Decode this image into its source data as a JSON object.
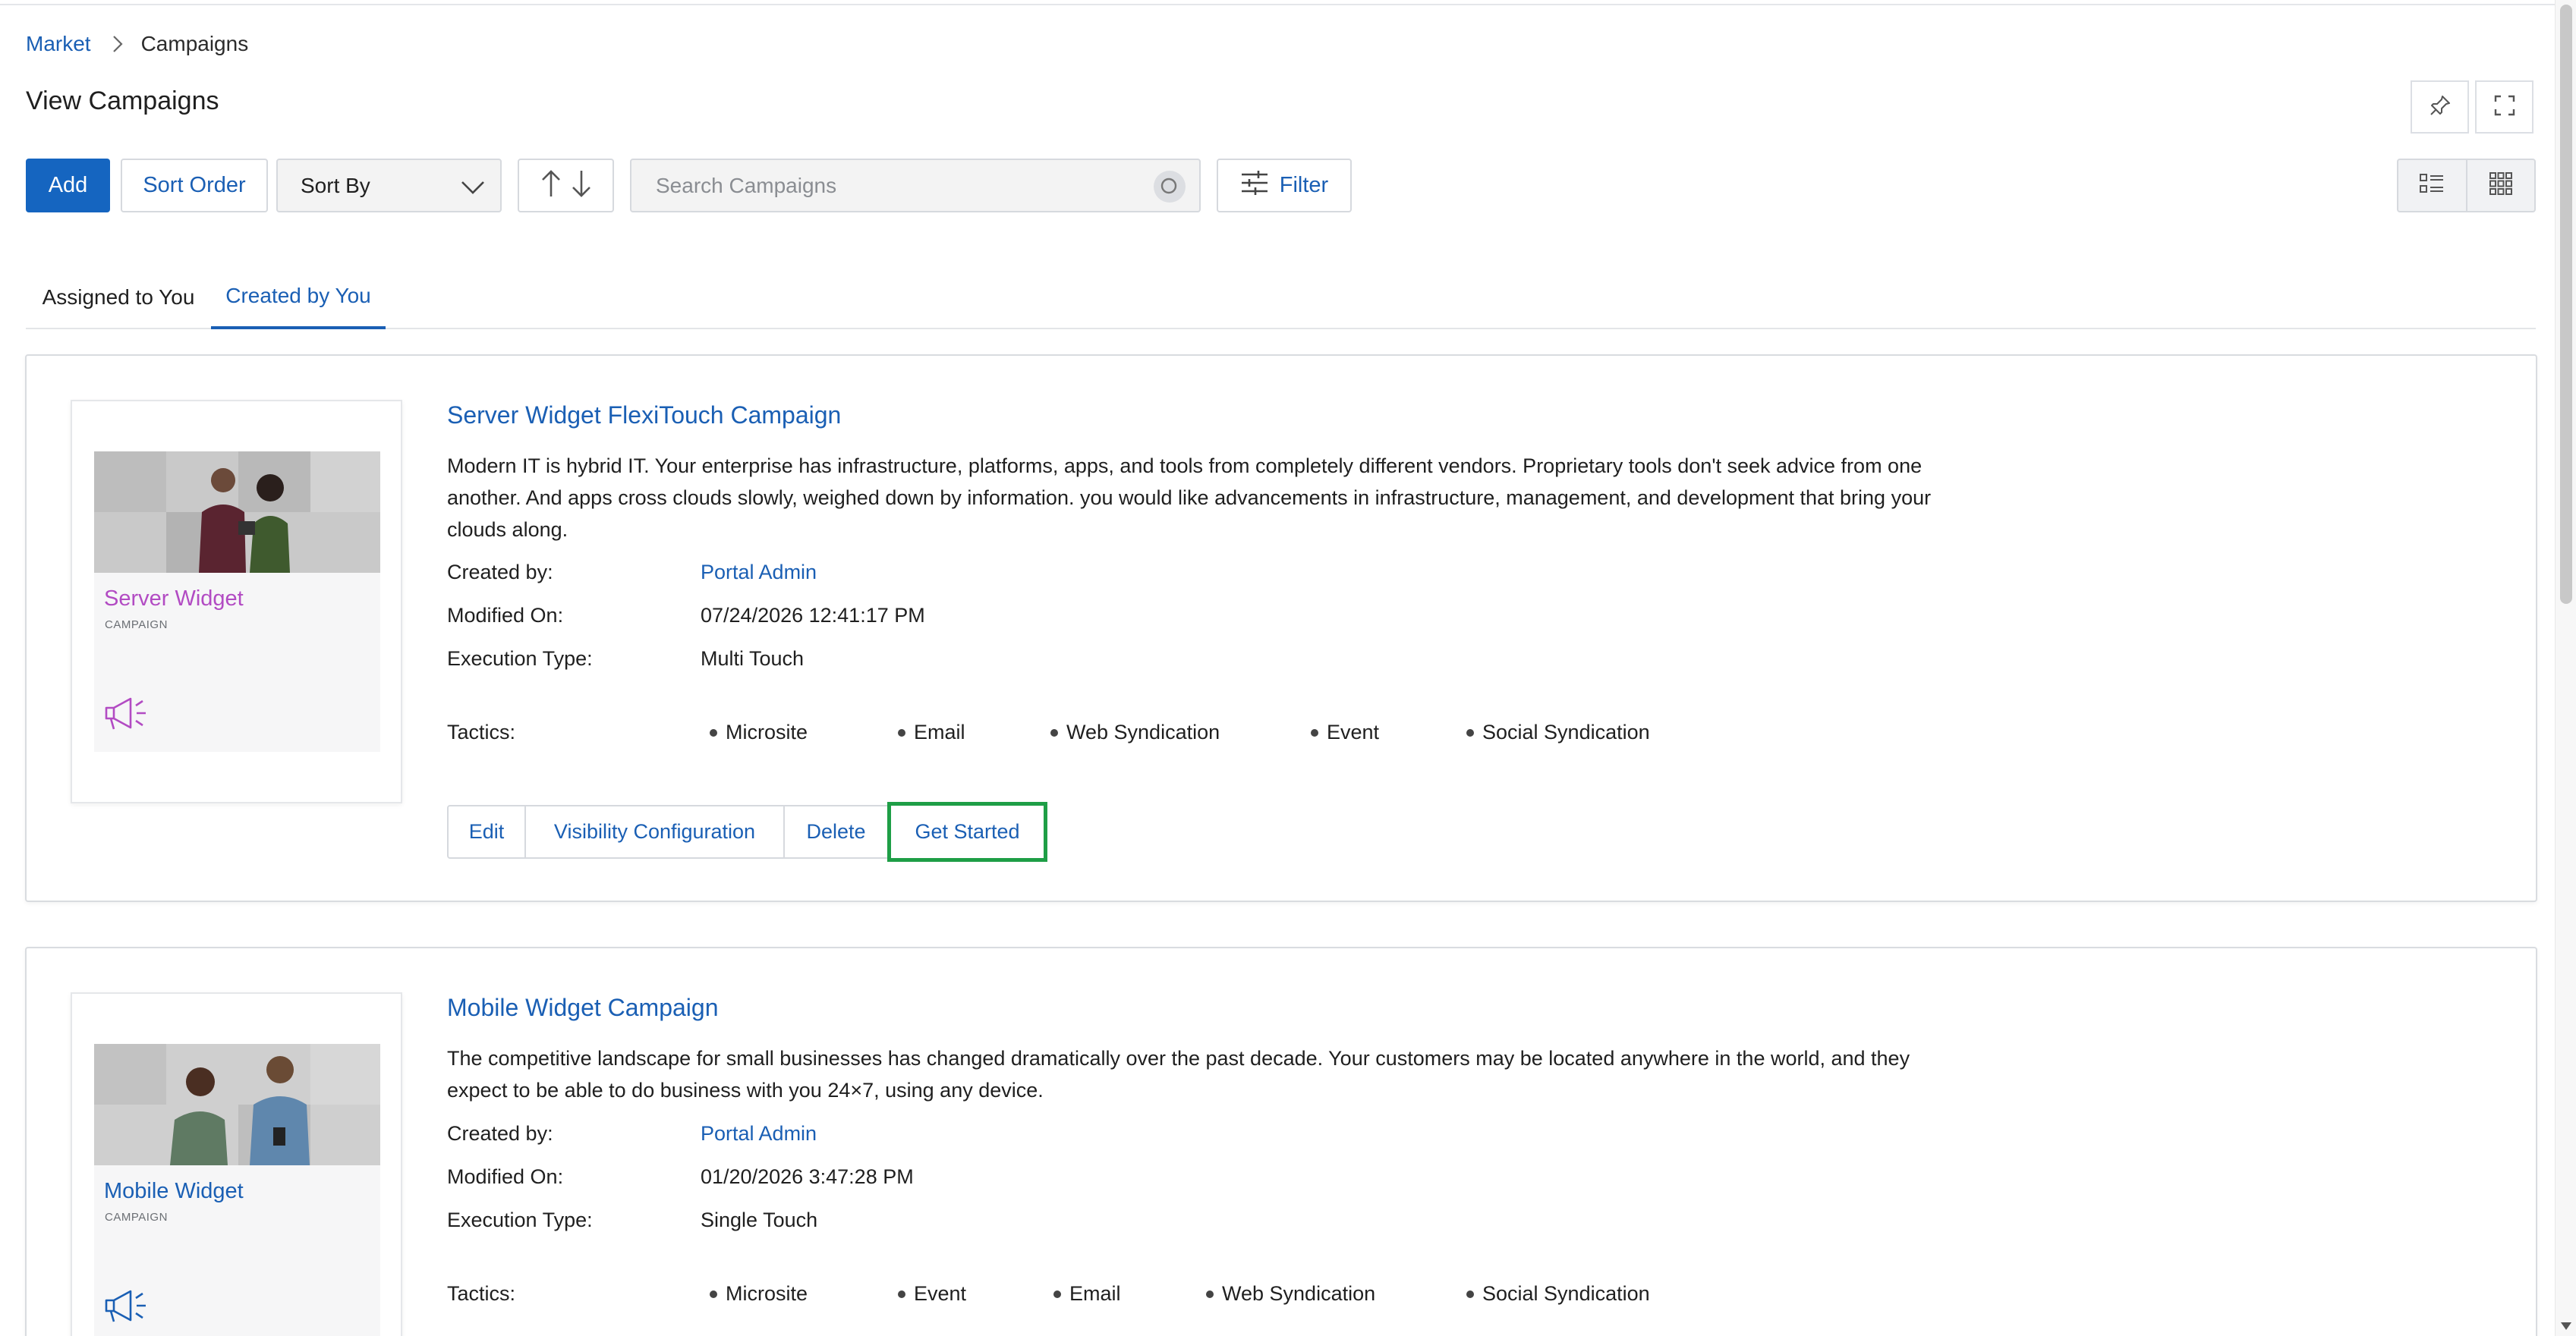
{
  "breadcrumb": {
    "parent": "Market",
    "current": "Campaigns"
  },
  "page": {
    "title": "View Campaigns"
  },
  "toolbar": {
    "add_label": "Add",
    "sort_order_label": "Sort Order",
    "sort_by_value": "Sort By",
    "search_placeholder": "Search Campaigns",
    "filter_label": "Filter"
  },
  "tabs": [
    {
      "label": "Assigned to You",
      "active": false
    },
    {
      "label": "Created by You",
      "active": true
    }
  ],
  "labels": {
    "created_by": "Created by:",
    "modified_on": "Modified On:",
    "execution_type": "Execution Type:",
    "tactics": "Tactics:"
  },
  "campaigns": [
    {
      "title": "Server Widget FlexiTouch Campaign",
      "description": "Modern IT is hybrid IT. Your enterprise has infrastructure, platforms, apps, and tools from completely different vendors. Proprietary tools don't seek advice from one another. And apps cross clouds slowly, weighed down by information. you would like advancements in infrastructure, management, and development that bring your clouds along.",
      "thumbnail_title": "Server Widget",
      "thumbnail_subtitle": "CAMPAIGN",
      "thumbnail_color": "#b24bc3",
      "created_by": "Portal Admin",
      "modified_on": "07/24/2026 12:41:17 PM",
      "execution_type": "Multi Touch",
      "tactics": [
        "Microsite",
        "Email",
        "Web Syndication",
        "Event",
        "Social Syndication"
      ],
      "actions": [
        "Edit",
        "Visibility Configuration",
        "Delete",
        "Get Started"
      ]
    },
    {
      "title": "Mobile Widget Campaign",
      "description": "The competitive landscape for small businesses has changed dramatically over the past decade. Your customers may be located anywhere in the world, and they expect to be able to do business with you 24×7, using any device.",
      "thumbnail_title": "Mobile Widget",
      "thumbnail_subtitle": "CAMPAIGN",
      "thumbnail_color": "#1a5fb4",
      "created_by": "Portal Admin",
      "modified_on": "01/20/2026 3:47:28 PM",
      "execution_type": "Single Touch",
      "tactics": [
        "Microsite",
        "Event",
        "Email",
        "Web Syndication",
        "Social Syndication"
      ]
    }
  ],
  "colors": {
    "accent": "#1565c0",
    "link": "#1a5fb4",
    "highlight": "#1e9e46"
  }
}
